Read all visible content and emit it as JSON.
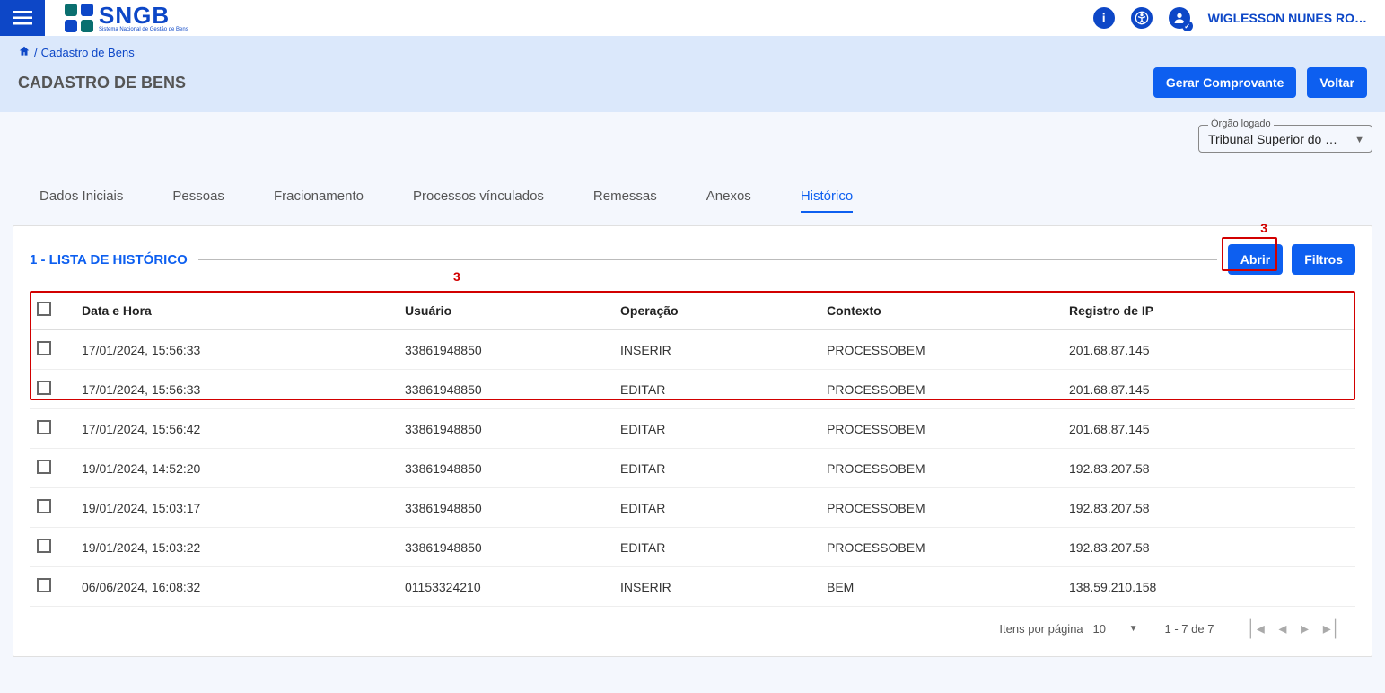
{
  "header": {
    "logo_big": "SNGB",
    "logo_small": "Sistema Nacional de Gestão de Bens",
    "user_name": "WIGLESSON NUNES RO…"
  },
  "breadcrumb": {
    "home_icon": "⌂",
    "sep": "/",
    "item": "Cadastro de Bens"
  },
  "page_title": "CADASTRO DE BENS",
  "actions": {
    "comprovante": "Gerar Comprovante",
    "voltar": "Voltar"
  },
  "orgao": {
    "legend": "Órgão logado",
    "value": "Tribunal Superior do Tra…"
  },
  "tabs": [
    {
      "label": "Dados Iniciais",
      "active": false
    },
    {
      "label": "Pessoas",
      "active": false
    },
    {
      "label": "Fracionamento",
      "active": false
    },
    {
      "label": "Processos vínculados",
      "active": false
    },
    {
      "label": "Remessas",
      "active": false
    },
    {
      "label": "Anexos",
      "active": false
    },
    {
      "label": "Histórico",
      "active": true
    }
  ],
  "section": {
    "title": "1 - LISTA DE HISTÓRICO",
    "abrir": "Abrir",
    "filtros": "Filtros"
  },
  "annotations": {
    "a1": "3",
    "a2": "3"
  },
  "table": {
    "header": {
      "data": "Data e Hora",
      "usuario": "Usuário",
      "operacao": "Operação",
      "contexto": "Contexto",
      "ip": "Registro de IP"
    },
    "rows": [
      {
        "data": "17/01/2024, 15:56:33",
        "usuario": "33861948850",
        "operacao": "INSERIR",
        "contexto": "PROCESSOBEM",
        "ip": "201.68.87.145"
      },
      {
        "data": "17/01/2024, 15:56:33",
        "usuario": "33861948850",
        "operacao": "EDITAR",
        "contexto": "PROCESSOBEM",
        "ip": "201.68.87.145"
      },
      {
        "data": "17/01/2024, 15:56:42",
        "usuario": "33861948850",
        "operacao": "EDITAR",
        "contexto": "PROCESSOBEM",
        "ip": "201.68.87.145"
      },
      {
        "data": "19/01/2024, 14:52:20",
        "usuario": "33861948850",
        "operacao": "EDITAR",
        "contexto": "PROCESSOBEM",
        "ip": "192.83.207.58"
      },
      {
        "data": "19/01/2024, 15:03:17",
        "usuario": "33861948850",
        "operacao": "EDITAR",
        "contexto": "PROCESSOBEM",
        "ip": "192.83.207.58"
      },
      {
        "data": "19/01/2024, 15:03:22",
        "usuario": "33861948850",
        "operacao": "EDITAR",
        "contexto": "PROCESSOBEM",
        "ip": "192.83.207.58"
      },
      {
        "data": "06/06/2024, 16:08:32",
        "usuario": "01153324210",
        "operacao": "INSERIR",
        "contexto": "BEM",
        "ip": "138.59.210.158"
      }
    ]
  },
  "pager": {
    "label": "Itens por página",
    "size": "10",
    "range": "1 - 7 de 7"
  }
}
